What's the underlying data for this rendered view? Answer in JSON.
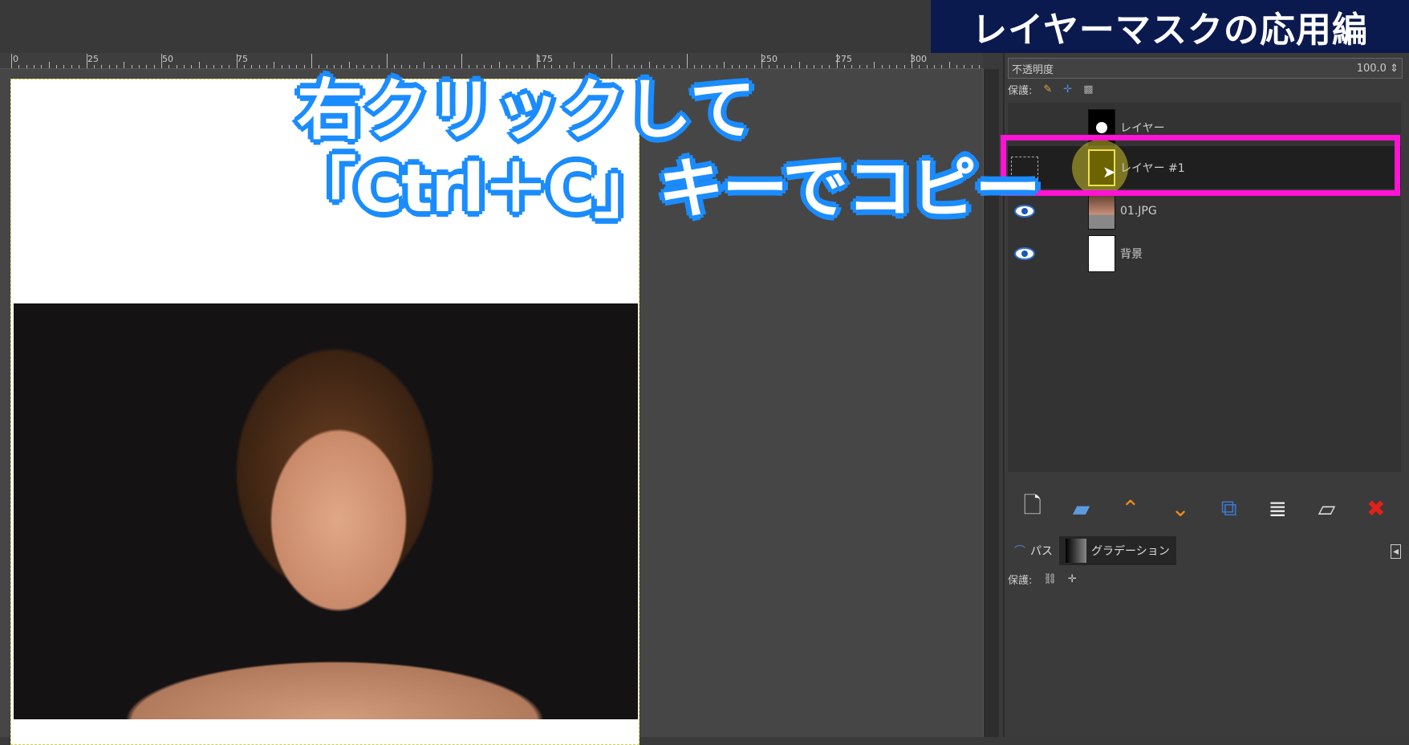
{
  "banner": {
    "title": "レイヤーマスクの応用編"
  },
  "ruler": {
    "labels": [
      "0",
      "25",
      "50",
      "75",
      "175",
      "250",
      "275",
      "300"
    ]
  },
  "overlay": {
    "line1": "右クリックして",
    "line2": "「Ctrl＋C」キーでコピー",
    "outline_color": "#1a8cff"
  },
  "panel": {
    "opacity_label": "不透明度",
    "opacity_value": "100.0",
    "protect_label": "保護:",
    "layers": [
      {
        "name": "レイヤー",
        "visible": false,
        "thumb": "mask-circle"
      },
      {
        "name": "レイヤー #1",
        "visible": false,
        "selected": true,
        "thumb": "layer-yellow"
      },
      {
        "name": "01.JPG",
        "visible": true,
        "thumb": "photo"
      },
      {
        "name": "背景",
        "visible": true,
        "thumb": "white"
      }
    ],
    "highlight_color": "#ff13d4",
    "buttons": [
      "new-layer-icon",
      "new-layer-group-icon",
      "raise-layer-icon",
      "lower-layer-icon",
      "duplicate-layer-icon",
      "merge-down-icon",
      "layer-mask-icon",
      "delete-layer-icon"
    ],
    "tabs": [
      {
        "label": "パス"
      },
      {
        "label": "グラデーション"
      }
    ],
    "protect2_label": "保護:"
  }
}
